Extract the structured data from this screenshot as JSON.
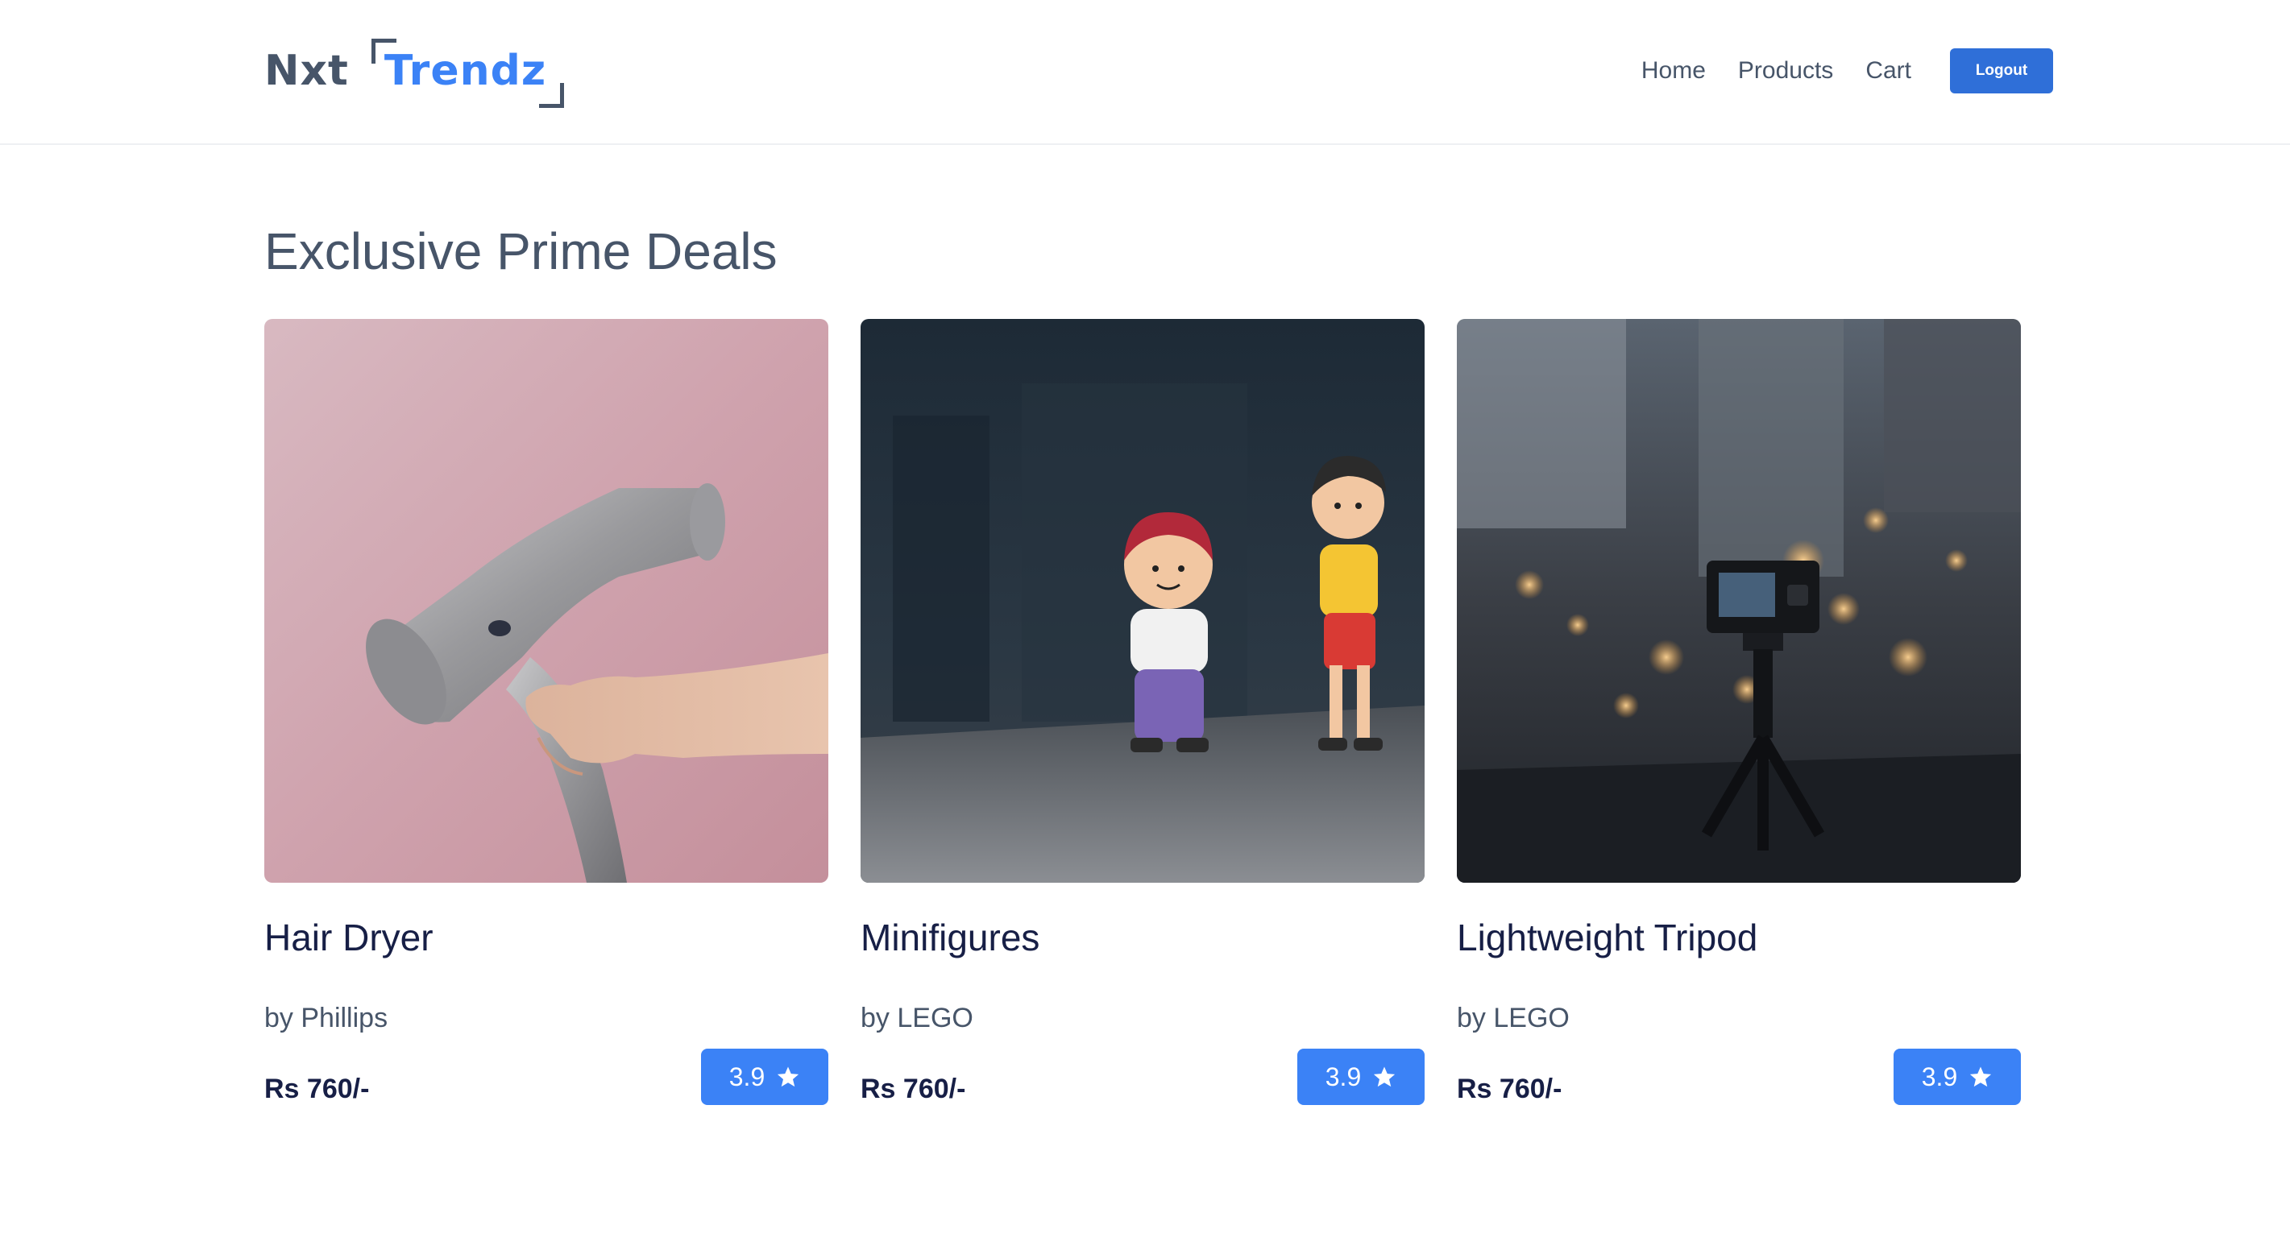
{
  "header": {
    "logo": {
      "part1": "Nxt",
      "part2": "Trendz"
    },
    "nav": [
      {
        "label": "Home"
      },
      {
        "label": "Products"
      },
      {
        "label": "Cart"
      }
    ],
    "logout_label": "Logout"
  },
  "main": {
    "title": "Exclusive Prime Deals",
    "products": [
      {
        "title": "Hair Dryer",
        "brand": "by Phillips",
        "price": "Rs 760/-",
        "rating": "3.9",
        "image_icon": "hair-dryer-image"
      },
      {
        "title": "Minifigures",
        "brand": "by LEGO",
        "price": "Rs 760/-",
        "rating": "3.9",
        "image_icon": "minifigures-image"
      },
      {
        "title": "Lightweight Tripod",
        "brand": "by LEGO",
        "price": "Rs 760/-",
        "rating": "3.9",
        "image_icon": "tripod-image"
      }
    ]
  },
  "colors": {
    "brand_blue": "#3b82f6",
    "logout_blue": "#2f6fd8",
    "text_slate": "#475569",
    "text_navy": "#171f46"
  }
}
